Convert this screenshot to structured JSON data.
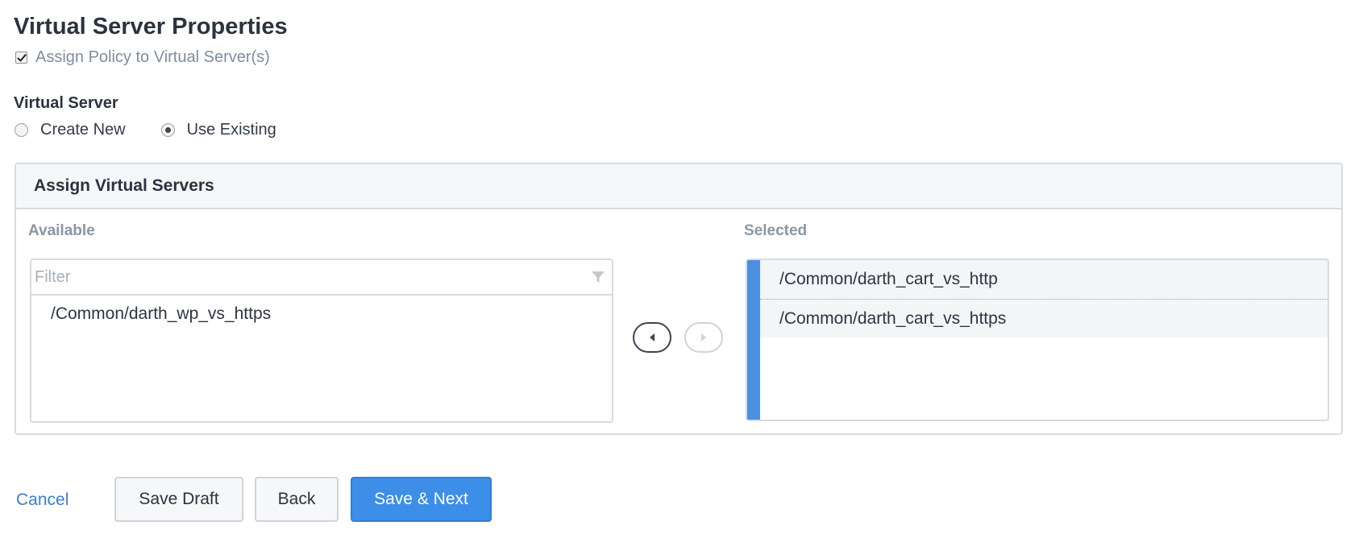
{
  "title": "Virtual Server Properties",
  "assign_policy": {
    "label": "Assign Policy to Virtual Server(s)",
    "checked": true
  },
  "virtual_server": {
    "label": "Virtual Server",
    "options": [
      {
        "label": "Create New",
        "selected": false
      },
      {
        "label": "Use Existing",
        "selected": true
      }
    ]
  },
  "panel": {
    "title": "Assign Virtual Servers",
    "available": {
      "label": "Available",
      "filter_placeholder": "Filter",
      "items": [
        "/Common/darth_wp_vs_https"
      ]
    },
    "selected": {
      "label": "Selected",
      "items": [
        "/Common/darth_cart_vs_http",
        "/Common/darth_cart_vs_https"
      ]
    }
  },
  "footer": {
    "cancel": "Cancel",
    "save_draft": "Save Draft",
    "back": "Back",
    "save_next": "Save & Next"
  },
  "colors": {
    "accent": "#3c8ee8",
    "selected_bar": "#4a8fe0",
    "link": "#3d7fc7"
  }
}
